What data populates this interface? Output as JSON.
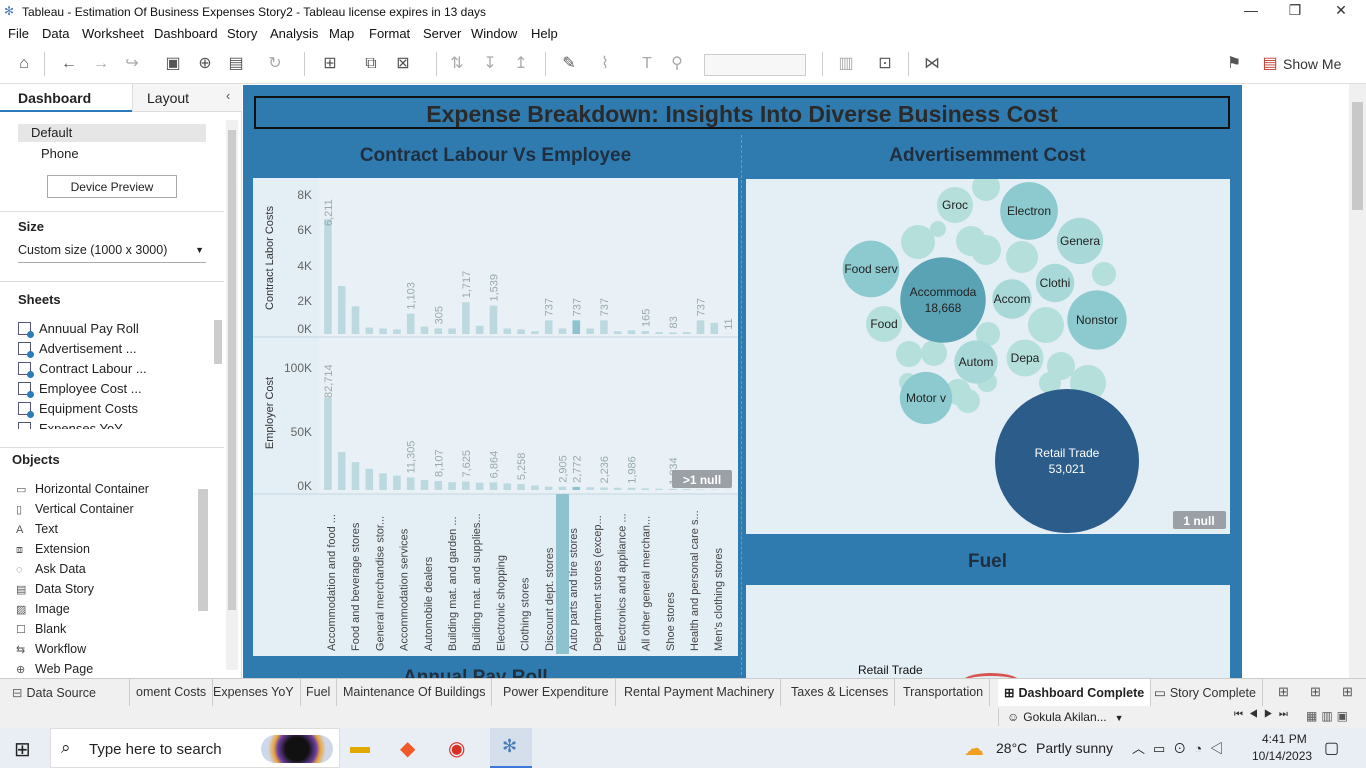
{
  "window": {
    "title": "Tableau - Estimation Of Business Expenses Story2 - Tableau license expires in 13 days"
  },
  "menu": [
    "File",
    "Data",
    "Worksheet",
    "Dashboard",
    "Story",
    "Analysis",
    "Map",
    "Format",
    "Server",
    "Window",
    "Help"
  ],
  "toolbar": {
    "show_me": "Show Me"
  },
  "left": {
    "tab_dashboard": "Dashboard",
    "tab_layout": "Layout",
    "device_default": "Default",
    "device_phone": "Phone",
    "device_preview": "Device Preview",
    "size_heading": "Size",
    "size_value": "Custom size (1000 x 3000)",
    "sheets_heading": "Sheets",
    "sheets": [
      "Annuual Pay Roll",
      "Advertisement ...",
      "Contract Labour ...",
      "Employee Cost ...",
      "Equipment Costs",
      "Expenses YoY"
    ],
    "objects_heading": "Objects",
    "objects": [
      "Horizontal Container",
      "Vertical Container",
      "Text",
      "Extension",
      "Ask Data",
      "Data Story",
      "Image",
      "Blank",
      "Workflow",
      "Web Page"
    ]
  },
  "dashboard": {
    "title": "Expense Breakdown: Insights Into Diverse Business Cost",
    "left_title": "Contract Labour Vs Employee",
    "right_title": "Advertisemment Cost",
    "fuel_title": "Fuel",
    "fuel_label": "Retail Trade",
    "bottom_partial": "Annual Pay Roll",
    "null_left": ">1 null",
    "null_right": "1 null",
    "y1_label": "Contract Labor Costs",
    "y2_label": "Employer Cost",
    "y1_ticks": [
      "8K",
      "6K",
      "4K",
      "2K",
      "0K"
    ],
    "y2_ticks": [
      "100K",
      "50K",
      "0K"
    ]
  },
  "chart_data": [
    {
      "type": "bar",
      "title": "Contract Labour Vs Employee",
      "categories": [
        "Accommodation and food ...",
        "Food and beverage stores",
        "General merchandise stor...",
        "Accommodation services",
        "Automobile dealers",
        "Building mat. and garden ...",
        "Building mat. and supplies...",
        "Electronic shopping",
        "Clothing stores",
        "Discount dept. stores",
        "Auto parts and tire stores",
        "Department stores (excep...",
        "Electronics and appliance ...",
        "All other general merchan...",
        "Shoe stores",
        "Health and personal care s...",
        "Men's clothing stores"
      ],
      "series": [
        {
          "name": "Contract Labor Costs",
          "values": [
            6211,
            2600,
            1500,
            350,
            300,
            250,
            1103,
            400,
            305,
            300,
            1717,
            450,
            1539,
            300,
            250,
            150,
            737,
            300,
            737,
            300,
            737,
            150,
            200,
            165,
            100,
            83,
            100,
            737,
            600,
            11
          ]
        },
        {
          "name": "Employer Cost",
          "values": [
            82714,
            34000,
            25000,
            19000,
            15000,
            13000,
            11305,
            9000,
            8107,
            7000,
            7625,
            6500,
            6864,
            6000,
            5258,
            4000,
            3000,
            2905,
            2772,
            2500,
            2236,
            2000,
            1986,
            1500,
            1200,
            1034,
            800,
            500,
            300,
            200
          ]
        }
      ],
      "bar_labels_top": [
        {
          "index": 0,
          "text": "6,211"
        },
        {
          "index": 6,
          "text": "1,103"
        },
        {
          "index": 8,
          "text": "305"
        },
        {
          "index": 10,
          "text": "1,717"
        },
        {
          "index": 12,
          "text": "1,539"
        },
        {
          "index": 16,
          "text": "737"
        },
        {
          "index": 18,
          "text": "737"
        },
        {
          "index": 20,
          "text": "737"
        },
        {
          "index": 23,
          "text": "165"
        },
        {
          "index": 25,
          "text": "83"
        },
        {
          "index": 27,
          "text": "737"
        },
        {
          "index": 29,
          "text": "11"
        }
      ],
      "bar_labels_bottom": [
        {
          "index": 0,
          "text": "82,714"
        },
        {
          "index": 6,
          "text": "11,305"
        },
        {
          "index": 8,
          "text": "8,107"
        },
        {
          "index": 10,
          "text": "7,625"
        },
        {
          "index": 12,
          "text": "6,864"
        },
        {
          "index": 14,
          "text": "5,258"
        },
        {
          "index": 17,
          "text": "2,905"
        },
        {
          "index": 18,
          "text": "2,772"
        },
        {
          "index": 20,
          "text": "2,236"
        },
        {
          "index": 22,
          "text": "1,986"
        },
        {
          "index": 25,
          "text": "1,034"
        }
      ],
      "highlight_index": 18,
      "ylim_top": [
        0,
        8000
      ],
      "ylim_bottom": [
        0,
        100000
      ]
    },
    {
      "type": "bubble",
      "title": "Advertisemment Cost",
      "bubbles": [
        {
          "label": "Retail Trade",
          "value": 53021,
          "value_label": "53,021",
          "color": "#2b5c8a"
        },
        {
          "label": "Accommoda",
          "value": 18668,
          "value_label": "18,668",
          "color": "#5aa3b5"
        },
        {
          "label": "Nonstor",
          "value": 9000,
          "color": "#8ccad0"
        },
        {
          "label": "Electron",
          "value": 8500,
          "color": "#8ccad0"
        },
        {
          "label": "Food serv",
          "value": 8200,
          "color": "#8ccad0"
        },
        {
          "label": "Motor v",
          "value": 7000,
          "color": "#8ccad0"
        },
        {
          "label": "Genera",
          "value": 5500,
          "color": "#a8d8d8"
        },
        {
          "label": "Autom",
          "value": 4800,
          "color": "#a8d8d8"
        },
        {
          "label": "Accom",
          "value": 4000,
          "color": "#a8d8d8"
        },
        {
          "label": "Clothi",
          "value": 3800,
          "color": "#a8d8d8"
        },
        {
          "label": "Depa",
          "value": 3500,
          "color": "#b4dfda"
        },
        {
          "label": "Food",
          "value": 3200,
          "color": "#b4dfda"
        },
        {
          "label": "Groc",
          "value": 2800,
          "color": "#b4dfda"
        }
      ]
    }
  ],
  "sheet_tabs": [
    "Data Source",
    "oment Costs",
    "Expenses YoY",
    "Fuel",
    "Maintenance Of Buildings",
    "Power Expenditure",
    "Rental Payment Machinery",
    "Taxes & Licenses",
    "Transportation",
    "Dashboard Complete",
    "Story Complete"
  ],
  "status": {
    "user": "Gokula Akilan..."
  },
  "taskbar": {
    "search": "Type here to search",
    "weather_temp": "28°C",
    "weather_text": "Partly sunny",
    "time": "4:41 PM",
    "date": "10/14/2023"
  },
  "colors": {
    "dash_bg": "#2f7bb0",
    "panel_bg": "#e4eef5",
    "bar": "#bcd9e0",
    "bubble_dark": "#2b5c8a"
  }
}
